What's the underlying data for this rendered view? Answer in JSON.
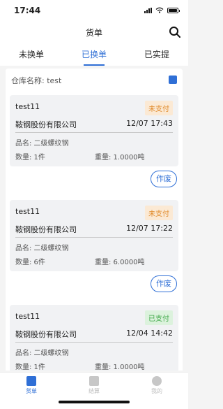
{
  "status_bar": {
    "time": "17:44"
  },
  "nav": {
    "title": "货单"
  },
  "tabs": [
    {
      "label": "未换单",
      "active": false
    },
    {
      "label": "已换单",
      "active": true
    },
    {
      "label": "已实提",
      "active": false
    }
  ],
  "warehouse": {
    "label": "仓库名称: test"
  },
  "orders": [
    {
      "code": "test11",
      "status": "未支付",
      "company": "鞍钢股份有限公司",
      "datetime": "12/07 17:43",
      "product": "品名: 二级螺纹钢",
      "qty": "数量: 1件",
      "weight": "重量: 1.0000吨",
      "void_label": "作废"
    },
    {
      "code": "test11",
      "status": "未支付",
      "company": "鞍钢股份有限公司",
      "datetime": "12/07 17:22",
      "product": "品名: 二级螺纹钢",
      "qty": "数量: 6件",
      "weight": "重量: 6.0000吨",
      "void_label": "作废"
    },
    {
      "code": "test11",
      "status": "已支付",
      "company": "鞍钢股份有限公司",
      "datetime": "12/04 14:42",
      "product": "品名: 二级螺纹钢",
      "qty": "数量: 1件",
      "weight": "重量: 1.0000吨"
    }
  ],
  "tabbar": [
    {
      "label": "货单",
      "icon": "clipboard-icon",
      "active": true
    },
    {
      "label": "结算",
      "icon": "receipt-icon",
      "active": false
    },
    {
      "label": "我的",
      "icon": "user-icon",
      "active": false
    }
  ],
  "colors": {
    "accent": "#2f6fd6",
    "unpaid": "#e08a2a",
    "paid": "#3fa848"
  }
}
